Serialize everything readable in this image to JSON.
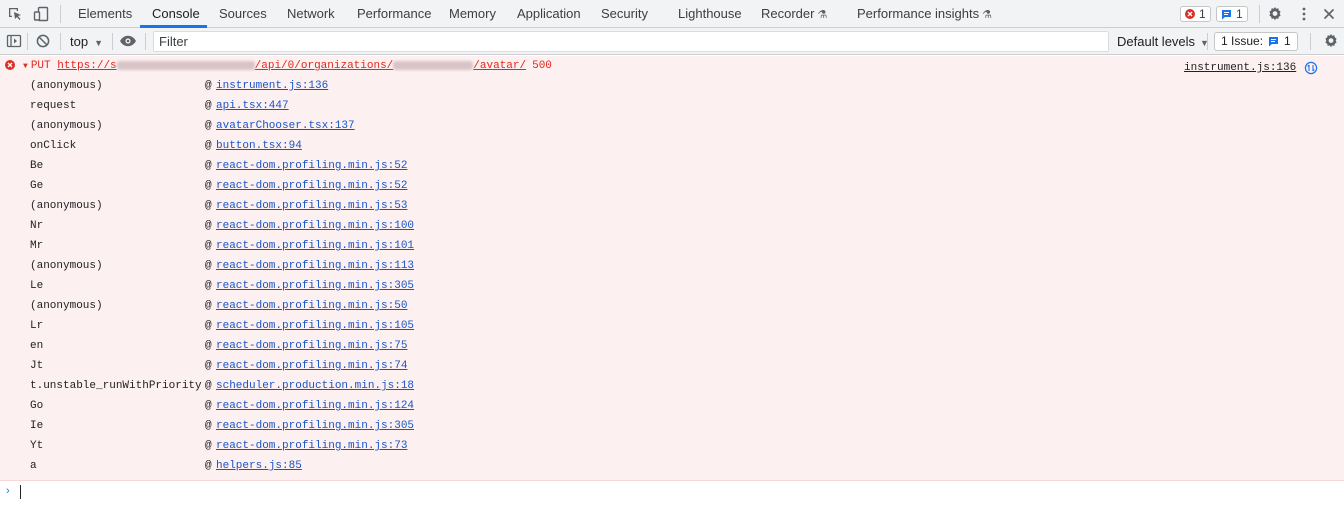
{
  "tabbar": {
    "tabs": [
      {
        "label": "Elements",
        "active": false
      },
      {
        "label": "Console",
        "active": true
      },
      {
        "label": "Sources",
        "active": false
      },
      {
        "label": "Network",
        "active": false
      },
      {
        "label": "Performance",
        "active": false
      },
      {
        "label": "Memory",
        "active": false
      },
      {
        "label": "Application",
        "active": false
      },
      {
        "label": "Security",
        "active": false
      },
      {
        "label": "Lighthouse",
        "active": false
      },
      {
        "label": "Recorder",
        "active": false,
        "icon": "flask-icon"
      },
      {
        "label": "Performance insights",
        "active": false,
        "icon": "flask-icon"
      }
    ],
    "error_count": "1",
    "message_count": "1"
  },
  "toolbar": {
    "context": "top",
    "filter_placeholder": "Filter",
    "filter_value": "",
    "levels_label": "Default levels",
    "issues_label": "1 Issue:",
    "issues_count": "1"
  },
  "console": {
    "error": {
      "method": "PUT",
      "url_prefix": "https://s",
      "url_middle": "/api/0/organizations/",
      "url_suffix": "/avatar/",
      "status": "500",
      "source": "instrument.js:136"
    },
    "stack": [
      {
        "fn": "(anonymous)",
        "at": "@",
        "loc": "instrument.js:136"
      },
      {
        "fn": "request",
        "at": "@",
        "loc": "api.tsx:447"
      },
      {
        "fn": "(anonymous)",
        "at": "@",
        "loc": "avatarChooser.tsx:137"
      },
      {
        "fn": "onClick",
        "at": "@",
        "loc": "button.tsx:94"
      },
      {
        "fn": "Be",
        "at": "@",
        "loc": "react-dom.profiling.min.js:52"
      },
      {
        "fn": "Ge",
        "at": "@",
        "loc": "react-dom.profiling.min.js:52"
      },
      {
        "fn": "(anonymous)",
        "at": "@",
        "loc": "react-dom.profiling.min.js:53"
      },
      {
        "fn": "Nr",
        "at": "@",
        "loc": "react-dom.profiling.min.js:100"
      },
      {
        "fn": "Mr",
        "at": "@",
        "loc": "react-dom.profiling.min.js:101"
      },
      {
        "fn": "(anonymous)",
        "at": "@",
        "loc": "react-dom.profiling.min.js:113"
      },
      {
        "fn": "Le",
        "at": "@",
        "loc": "react-dom.profiling.min.js:305"
      },
      {
        "fn": "(anonymous)",
        "at": "@",
        "loc": "react-dom.profiling.min.js:50"
      },
      {
        "fn": "Lr",
        "at": "@",
        "loc": "react-dom.profiling.min.js:105"
      },
      {
        "fn": "en",
        "at": "@",
        "loc": "react-dom.profiling.min.js:75"
      },
      {
        "fn": "Jt",
        "at": "@",
        "loc": "react-dom.profiling.min.js:74"
      },
      {
        "fn": "t.unstable_runWithPriority",
        "at": "@",
        "loc": "scheduler.production.min.js:18"
      },
      {
        "fn": "Go",
        "at": "@",
        "loc": "react-dom.profiling.min.js:124"
      },
      {
        "fn": "Ie",
        "at": "@",
        "loc": "react-dom.profiling.min.js:305"
      },
      {
        "fn": "Yt",
        "at": "@",
        "loc": "react-dom.profiling.min.js:73"
      },
      {
        "fn": "a",
        "at": "@",
        "loc": "helpers.js:85"
      }
    ],
    "prompt": "›"
  },
  "colors": {
    "accent": "#1a73e8",
    "error": "#d93025",
    "error_bg": "#fcf0f0",
    "link": "#1a55c4"
  }
}
